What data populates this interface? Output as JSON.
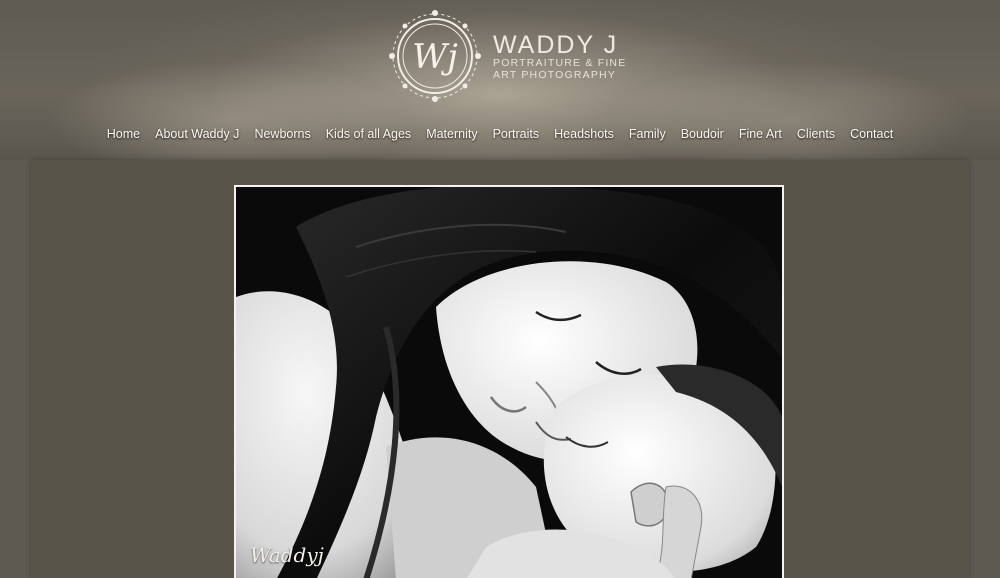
{
  "brand": {
    "monogram": "Wj",
    "name": "WADDY J",
    "tagline_line1": "PORTRAITURE & FINE",
    "tagline_line2": "ART PHOTOGRAPHY",
    "logo_icon": "ornate-circle-monogram"
  },
  "nav": {
    "items": [
      "Home",
      "About Waddy J",
      "Newborns",
      "Kids of all Ages",
      "Maternity",
      "Portraits",
      "Headshots",
      "Family",
      "Boudoir",
      "Fine Art",
      "Clients",
      "Contact"
    ]
  },
  "photo": {
    "subject": "black-and-white-mother-and-newborn",
    "watermark": "Waddyj"
  },
  "colors": {
    "background": "#5e5a52",
    "content_panel": "#585449",
    "nav_text": "#fbf8f2"
  }
}
